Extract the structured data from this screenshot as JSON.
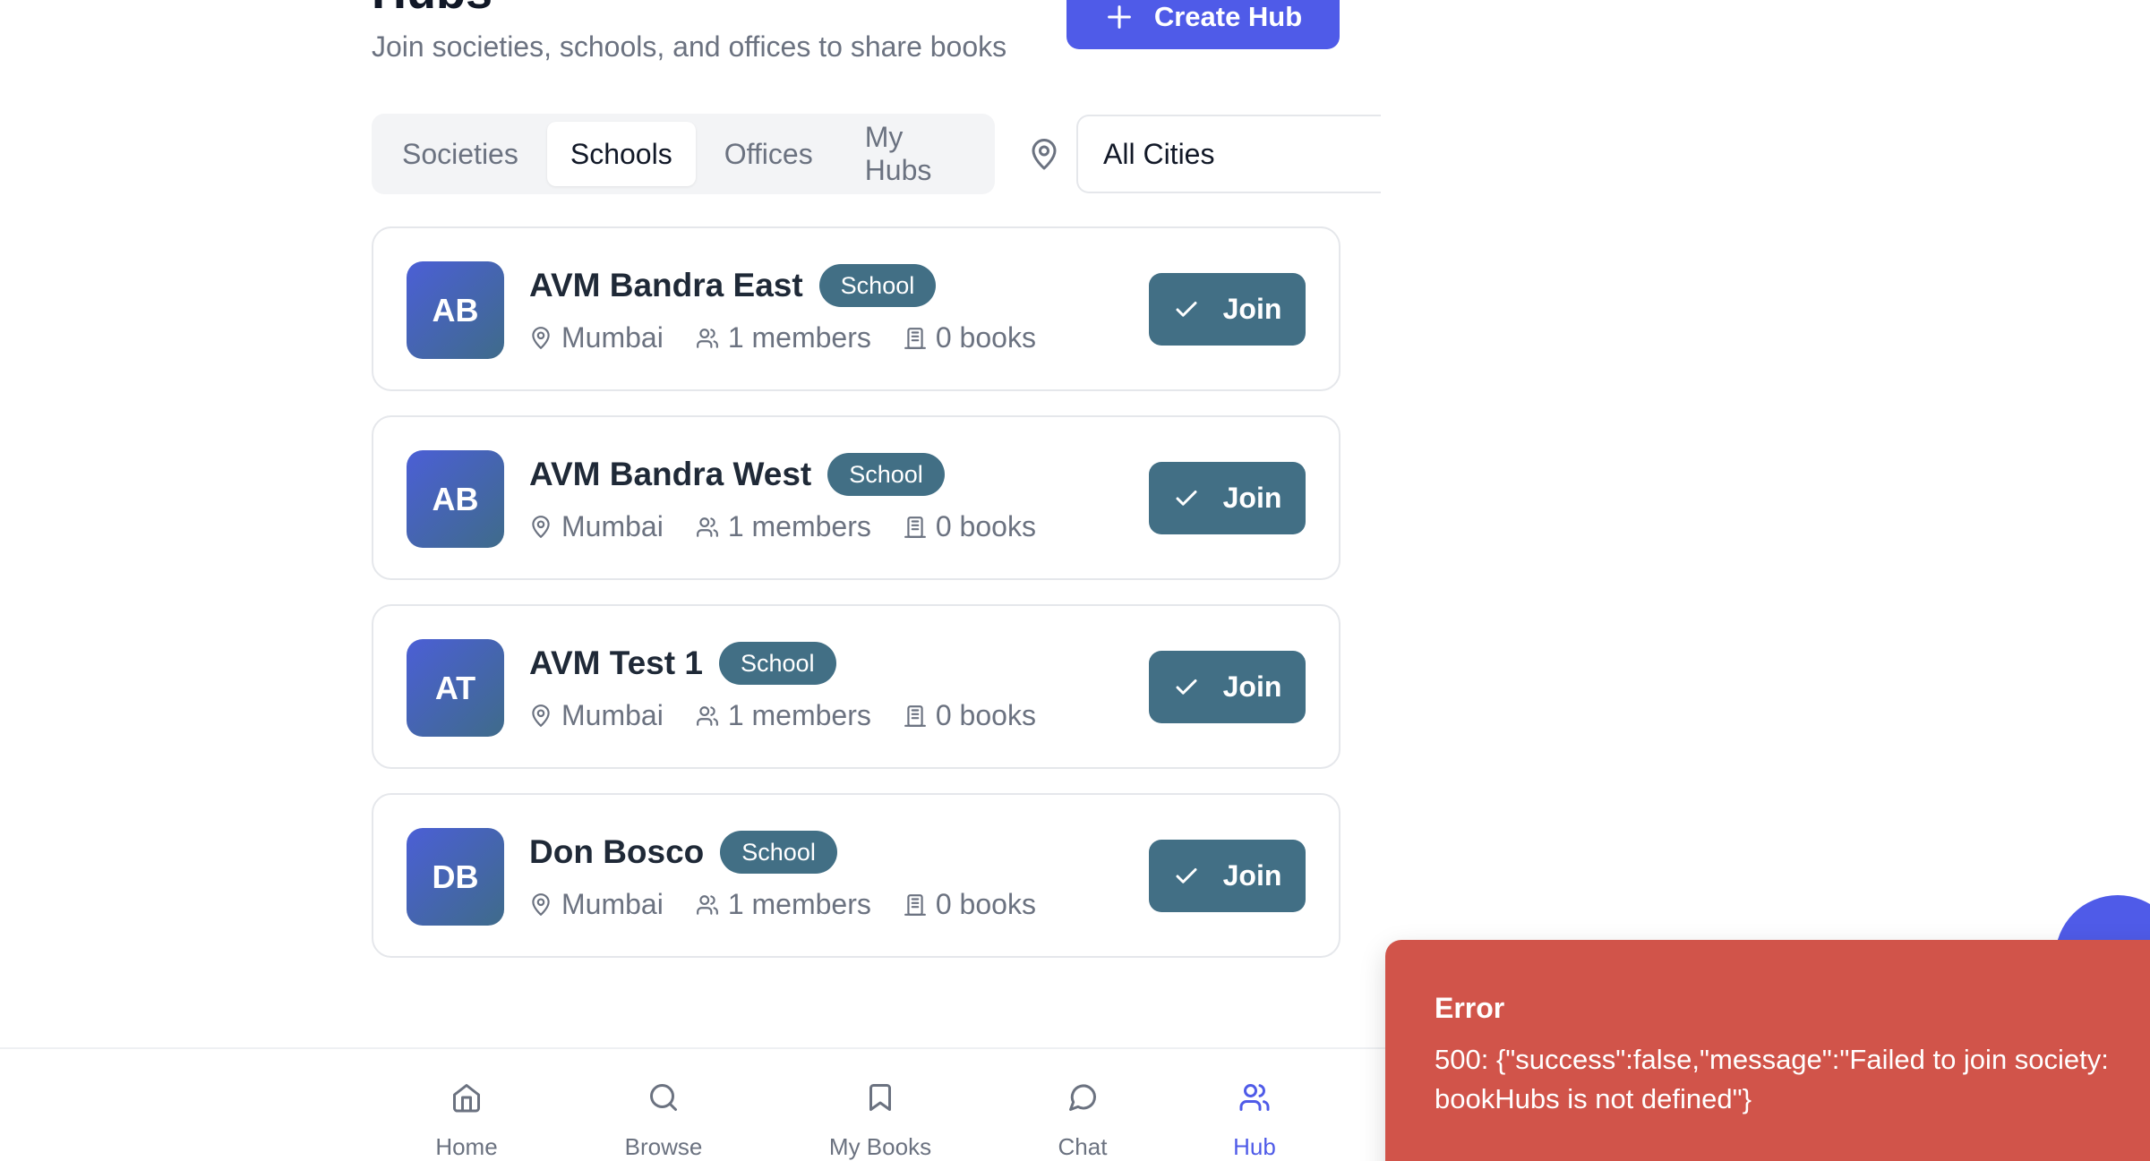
{
  "header": {
    "title": "Hubs",
    "subtitle": "Join societies, schools, and offices to share books",
    "create_button": "Create Hub"
  },
  "tabs": [
    {
      "label": "Societies",
      "active": false
    },
    {
      "label": "Schools",
      "active": true
    },
    {
      "label": "Offices",
      "active": false
    },
    {
      "label": "My Hubs",
      "active": false
    }
  ],
  "city_filter": {
    "value": "All Cities"
  },
  "hubs": [
    {
      "initials": "AB",
      "name": "AVM Bandra East",
      "type": "School",
      "city": "Mumbai",
      "members": "1 members",
      "books": "0 books",
      "action": "Join"
    },
    {
      "initials": "AB",
      "name": "AVM Bandra West",
      "type": "School",
      "city": "Mumbai",
      "members": "1 members",
      "books": "0 books",
      "action": "Join"
    },
    {
      "initials": "AT",
      "name": "AVM Test 1",
      "type": "School",
      "city": "Mumbai",
      "members": "1 members",
      "books": "0 books",
      "action": "Join"
    },
    {
      "initials": "DB",
      "name": "Don Bosco",
      "type": "School",
      "city": "Mumbai",
      "members": "1 members",
      "books": "0 books",
      "action": "Join"
    }
  ],
  "nav": [
    {
      "label": "Home",
      "icon": "home-icon"
    },
    {
      "label": "Browse",
      "icon": "search-icon"
    },
    {
      "label": "My Books",
      "icon": "bookmark-icon"
    },
    {
      "label": "Chat",
      "icon": "chat-icon"
    },
    {
      "label": "Hub",
      "icon": "users-icon",
      "active": true
    }
  ],
  "toast": {
    "title": "Error",
    "message": "500: {\"success\":false,\"message\":\"Failed to join society: bookHubs is not defined\"}"
  },
  "colors": {
    "primary": "#4f5be8",
    "teal": "#426f85",
    "error": "#d1544a"
  }
}
